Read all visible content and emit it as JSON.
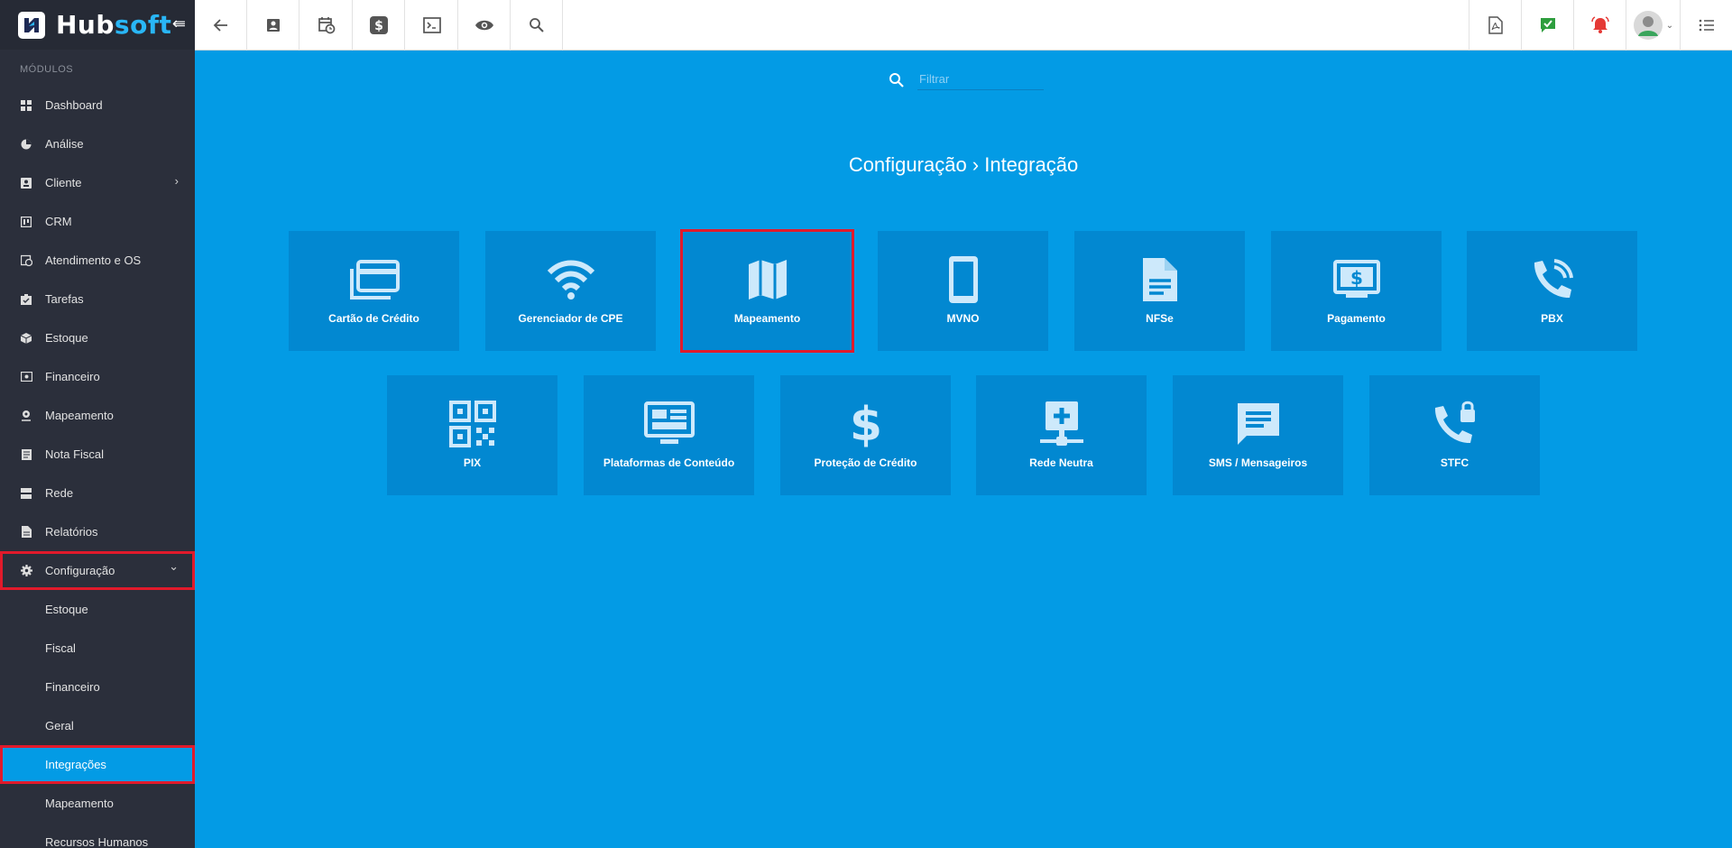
{
  "brand": {
    "name_a": "Hub",
    "name_b": "soft",
    "logo_letter": "H"
  },
  "sidebar": {
    "section_title": "MÓDULOS",
    "items": [
      {
        "label": "Dashboard",
        "icon": "dashboard-icon"
      },
      {
        "label": "Análise",
        "icon": "pie-chart-icon"
      },
      {
        "label": "Cliente",
        "icon": "contact-card-icon",
        "chevron": "›"
      },
      {
        "label": "CRM",
        "icon": "crm-icon"
      },
      {
        "label": "Atendimento e OS",
        "icon": "calendar-clock-icon"
      },
      {
        "label": "Tarefas",
        "icon": "tasks-icon"
      },
      {
        "label": "Estoque",
        "icon": "package-icon"
      },
      {
        "label": "Financeiro",
        "icon": "money-icon"
      },
      {
        "label": "Mapeamento",
        "icon": "map-pin-icon"
      },
      {
        "label": "Nota Fiscal",
        "icon": "receipt-icon"
      },
      {
        "label": "Rede",
        "icon": "server-icon"
      },
      {
        "label": "Relatórios",
        "icon": "report-icon"
      },
      {
        "label": "Configuração",
        "icon": "gear-icon",
        "chevron": "⌄"
      }
    ],
    "subitems": [
      "Estoque",
      "Fiscal",
      "Financeiro",
      "Geral",
      "Integrações",
      "Mapeamento",
      "Recursos Humanos"
    ]
  },
  "filter": {
    "placeholder": "Filtrar"
  },
  "page": {
    "title": "Configuração › Integração"
  },
  "cards": [
    {
      "label": "Cartão de Crédito",
      "icon": "credit-card-icon"
    },
    {
      "label": "Gerenciador de CPE",
      "icon": "wifi-icon"
    },
    {
      "label": "Mapeamento",
      "icon": "map-icon"
    },
    {
      "label": "MVNO",
      "icon": "smartphone-icon"
    },
    {
      "label": "NFSe",
      "icon": "document-icon"
    },
    {
      "label": "Pagamento",
      "icon": "payment-icon"
    },
    {
      "label": "PBX",
      "icon": "phone-call-icon"
    },
    {
      "label": "PIX",
      "icon": "qr-code-icon"
    },
    {
      "label": "Plataformas de Conteúdo",
      "icon": "monitor-icon"
    },
    {
      "label": "Proteção de Crédito",
      "icon": "dollar-icon"
    },
    {
      "label": "Rede Neutra",
      "icon": "network-icon"
    },
    {
      "label": "SMS / Mensageiros",
      "icon": "message-icon"
    },
    {
      "label": "STFC",
      "icon": "phone-lock-icon"
    }
  ],
  "colors": {
    "main_bg": "#039be5",
    "card_bg": "#0288d1",
    "sidebar_bg": "#2b2f3b",
    "highlight": "#e11a2b"
  }
}
